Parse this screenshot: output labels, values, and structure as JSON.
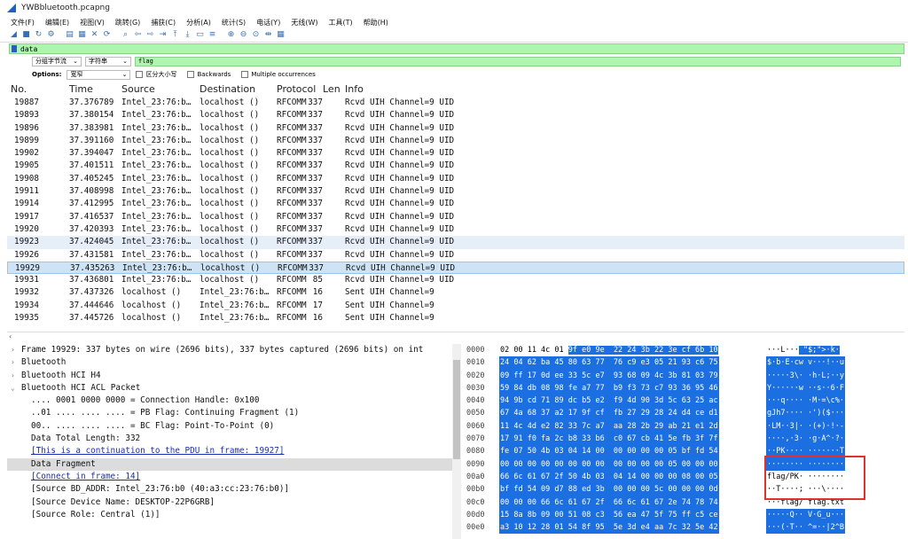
{
  "window": {
    "title": "YWBbluetooth.pcapng"
  },
  "menu": [
    "文件(F)",
    "编辑(E)",
    "视图(V)",
    "跳转(G)",
    "捕获(C)",
    "分析(A)",
    "统计(S)",
    "电话(Y)",
    "无线(W)",
    "工具(T)",
    "帮助(H)"
  ],
  "toolbar_icons": [
    "fin-icon",
    "stop-icon",
    "restart-icon",
    "options-icon",
    "open-icon",
    "save-icon",
    "close-icon",
    "reload-icon",
    "find-icon",
    "back-icon",
    "forward-icon",
    "goto-icon",
    "first-icon",
    "last-icon",
    "autoscroll-icon",
    "colorize-icon",
    "zoom-in-icon",
    "zoom-out-icon",
    "zoom-reset-icon",
    "resize-columns-icon",
    "layout-icon"
  ],
  "display_filter": {
    "value": "data"
  },
  "search": {
    "scope": "分组字节流",
    "type": "字符串",
    "value": "flag",
    "options_label": "Options:",
    "charset": "宽窄",
    "case_label": "区分大小写",
    "backwards_label": "Backwards",
    "multiple_label": "Multiple occurrences"
  },
  "packet_list": {
    "columns": {
      "no": "No.",
      "time": "Time",
      "source": "Source",
      "destination": "Destination",
      "protocol": "Protocol",
      "length": "Len",
      "info": "Info"
    },
    "rows": [
      {
        "no": "19887",
        "time": "37.376789",
        "src": "Intel_23:76:b…",
        "dst": "localhost ()",
        "proto": "RFCOMM",
        "len": "337",
        "info": "Rcvd UIH Channel=9 UID"
      },
      {
        "no": "19893",
        "time": "37.380154",
        "src": "Intel_23:76:b…",
        "dst": "localhost ()",
        "proto": "RFCOMM",
        "len": "337",
        "info": "Rcvd UIH Channel=9 UID"
      },
      {
        "no": "19896",
        "time": "37.383981",
        "src": "Intel_23:76:b…",
        "dst": "localhost ()",
        "proto": "RFCOMM",
        "len": "337",
        "info": "Rcvd UIH Channel=9 UID"
      },
      {
        "no": "19899",
        "time": "37.391160",
        "src": "Intel_23:76:b…",
        "dst": "localhost ()",
        "proto": "RFCOMM",
        "len": "337",
        "info": "Rcvd UIH Channel=9 UID"
      },
      {
        "no": "19902",
        "time": "37.394047",
        "src": "Intel_23:76:b…",
        "dst": "localhost ()",
        "proto": "RFCOMM",
        "len": "337",
        "info": "Rcvd UIH Channel=9 UID"
      },
      {
        "no": "19905",
        "time": "37.401511",
        "src": "Intel_23:76:b…",
        "dst": "localhost ()",
        "proto": "RFCOMM",
        "len": "337",
        "info": "Rcvd UIH Channel=9 UID"
      },
      {
        "no": "19908",
        "time": "37.405245",
        "src": "Intel_23:76:b…",
        "dst": "localhost ()",
        "proto": "RFCOMM",
        "len": "337",
        "info": "Rcvd UIH Channel=9 UID"
      },
      {
        "no": "19911",
        "time": "37.408998",
        "src": "Intel_23:76:b…",
        "dst": "localhost ()",
        "proto": "RFCOMM",
        "len": "337",
        "info": "Rcvd UIH Channel=9 UID"
      },
      {
        "no": "19914",
        "time": "37.412995",
        "src": "Intel_23:76:b…",
        "dst": "localhost ()",
        "proto": "RFCOMM",
        "len": "337",
        "info": "Rcvd UIH Channel=9 UID"
      },
      {
        "no": "19917",
        "time": "37.416537",
        "src": "Intel_23:76:b…",
        "dst": "localhost ()",
        "proto": "RFCOMM",
        "len": "337",
        "info": "Rcvd UIH Channel=9 UID"
      },
      {
        "no": "19920",
        "time": "37.420393",
        "src": "Intel_23:76:b…",
        "dst": "localhost ()",
        "proto": "RFCOMM",
        "len": "337",
        "info": "Rcvd UIH Channel=9 UID"
      },
      {
        "no": "19923",
        "time": "37.424045",
        "src": "Intel_23:76:b…",
        "dst": "localhost ()",
        "proto": "RFCOMM",
        "len": "337",
        "info": "Rcvd UIH Channel=9 UID"
      },
      {
        "no": "19926",
        "time": "37.431581",
        "src": "Intel_23:76:b…",
        "dst": "localhost ()",
        "proto": "RFCOMM",
        "len": "337",
        "info": "Rcvd UIH Channel=9 UID"
      },
      {
        "no": "19929",
        "time": "37.435263",
        "src": "Intel_23:76:b…",
        "dst": "localhost ()",
        "proto": "RFCOMM",
        "len": "337",
        "info": "Rcvd UIH Channel=9 UID"
      },
      {
        "no": "19931",
        "time": "37.436801",
        "src": "Intel_23:76:b…",
        "dst": "localhost ()",
        "proto": "RFCOMM",
        "len": "85",
        "info": "Rcvd UIH Channel=9 UID"
      },
      {
        "no": "19932",
        "time": "37.437326",
        "src": "localhost ()",
        "dst": "Intel_23:76:b…",
        "proto": "RFCOMM",
        "len": "16",
        "info": "Sent UIH Channel=9"
      },
      {
        "no": "19934",
        "time": "37.444646",
        "src": "localhost ()",
        "dst": "Intel_23:76:b…",
        "proto": "RFCOMM",
        "len": "17",
        "info": "Sent UIH Channel=9"
      },
      {
        "no": "19935",
        "time": "37.445726",
        "src": "localhost ()",
        "dst": "Intel_23:76:b…",
        "proto": "RFCOMM",
        "len": "16",
        "info": "Sent UIH Channel=9"
      }
    ]
  },
  "details": [
    {
      "text": "Frame 19929: 337 bytes on wire (2696 bits), 337 bytes captured (2696 bits) on int",
      "arrow": "›",
      "indent": 0
    },
    {
      "text": "Bluetooth",
      "arrow": "›",
      "indent": 0
    },
    {
      "text": "Bluetooth HCI H4",
      "arrow": "›",
      "indent": 0
    },
    {
      "text": "Bluetooth HCI ACL Packet",
      "arrow": "⌄",
      "indent": 0
    },
    {
      "text": ".... 0001 0000 0000 = Connection Handle: 0x100",
      "arrow": "",
      "indent": 1
    },
    {
      "text": "..01 .... .... .... = PB Flag: Continuing Fragment (1)",
      "arrow": "",
      "indent": 1
    },
    {
      "text": "00.. .... .... .... = BC Flag: Point-To-Point (0)",
      "arrow": "",
      "indent": 1
    },
    {
      "text": "Data Total Length: 332",
      "arrow": "",
      "indent": 1
    },
    {
      "text": "[This is a continuation to the PDU in frame: 19927]",
      "arrow": "",
      "indent": 1,
      "link": true
    },
    {
      "text": "Data Fragment",
      "arrow": "",
      "indent": 1,
      "highlight": true
    },
    {
      "text": "[Connect in frame: 14]",
      "arrow": "",
      "indent": 1,
      "link": true
    },
    {
      "text": "[Source BD_ADDR: Intel_23:76:b0 (40:a3:cc:23:76:b0)]",
      "arrow": "",
      "indent": 1
    },
    {
      "text": "[Source Device Name: DESKTOP-22P6GRB]",
      "arrow": "",
      "indent": 1
    },
    {
      "text": "[Source Role: Central (1)]",
      "arrow": "",
      "indent": 1
    }
  ],
  "hex": [
    {
      "off": "0000",
      "pre": "02 00 11 4c 01 ",
      "hl": "9f e0 9e  22 24 3b 22 3e cf 6b 10",
      "apre": "···L···",
      "ahl": " \"$;\">·k·"
    },
    {
      "off": "0010",
      "pre": "",
      "hl": "24 04 62 ba 45 80 63 77  76 c9 e3 05 21 93 c6 75",
      "apre": "",
      "ahl": "$·b·E·cw v···!··u"
    },
    {
      "off": "0020",
      "pre": "",
      "hl": "09 ff 17 0d ee 33 5c e7  93 68 09 4c 3b 81 03 79",
      "apre": "",
      "ahl": "·····3\\· ·h·L;··y"
    },
    {
      "off": "0030",
      "pre": "",
      "hl": "59 84 db 08 98 fe a7 77  b9 f3 73 c7 93 36 95 46",
      "apre": "",
      "ahl": "Y······w ··s··6·F"
    },
    {
      "off": "0040",
      "pre": "",
      "hl": "94 9b cd 71 89 dc b5 e2  f9 4d 90 3d 5c 63 25 ac",
      "apre": "",
      "ahl": "···q···· ·M·=\\c%·"
    },
    {
      "off": "0050",
      "pre": "",
      "hl": "67 4a 68 37 a2 17 9f cf  fb 27 29 28 24 d4 ce d1",
      "apre": "",
      "ahl": "gJh7···· ·')($···"
    },
    {
      "off": "0060",
      "pre": "",
      "hl": "11 4c 4d e2 82 33 7c a7  aa 28 2b 29 ab 21 e1 2d",
      "apre": "",
      "ahl": "·LM··3|· ·(+)·!·-"
    },
    {
      "off": "0070",
      "pre": "",
      "hl": "17 91 f0 fa 2c b8 33 b6  c0 67 cb 41 5e fb 3f 7f",
      "apre": "",
      "ahl": "····,·3· ·g·A^·?·"
    },
    {
      "off": "0080",
      "pre": "",
      "hl": "fe 07 50 4b 03 04 14 00  00 00 00 00 05 bf fd 54",
      "apre": "",
      "ahl": "··PK···· ·······T"
    },
    {
      "off": "0090",
      "pre": "",
      "hl": "00 00 00 00 00 00 00 00  00 00 00 00 05 00 00 00",
      "apre": "",
      "ahl": "········ ········"
    },
    {
      "off": "00a0",
      "pre": "",
      "hl": "66 6c 61 67 2f 50 4b 03  04 14 00 00 00 08 00 05",
      "apre": "",
      "ahl": "flag/PK· ········",
      "boxed": true
    },
    {
      "off": "00b0",
      "pre": "",
      "hl": "bf fd 54 09 d7 88 ed 3b  00 00 00 5c 00 00 00 0d",
      "apre": "",
      "ahl": "··T····; ···\\····",
      "boxed": true
    },
    {
      "off": "00c0",
      "pre": "",
      "hl": "00 00 00 66 6c 61 67 2f  66 6c 61 67 2e 74 78 74",
      "apre": "",
      "ahl": "···flag/ flag.txt",
      "boxed": true
    },
    {
      "off": "00d0",
      "pre": "",
      "hl": "15 8a 8b 09 00 51 08 c3  56 ea 47 5f 75 ff c5 ce",
      "apre": "",
      "ahl": "·····Q·· V·G_u···"
    },
    {
      "off": "00e0",
      "pre": "",
      "hl": "a3 10 12 28 01 54 8f 95  5e 3d e4 aa 7c 32 5e 42",
      "apre": "",
      "ahl": "···(·T·· ^=··|2^B"
    }
  ],
  "colors": {
    "filter_bg": "#aff5af",
    "selection": "#1c6fe0",
    "row_selected": "#cfe3f7",
    "annotation": "#e03030"
  }
}
